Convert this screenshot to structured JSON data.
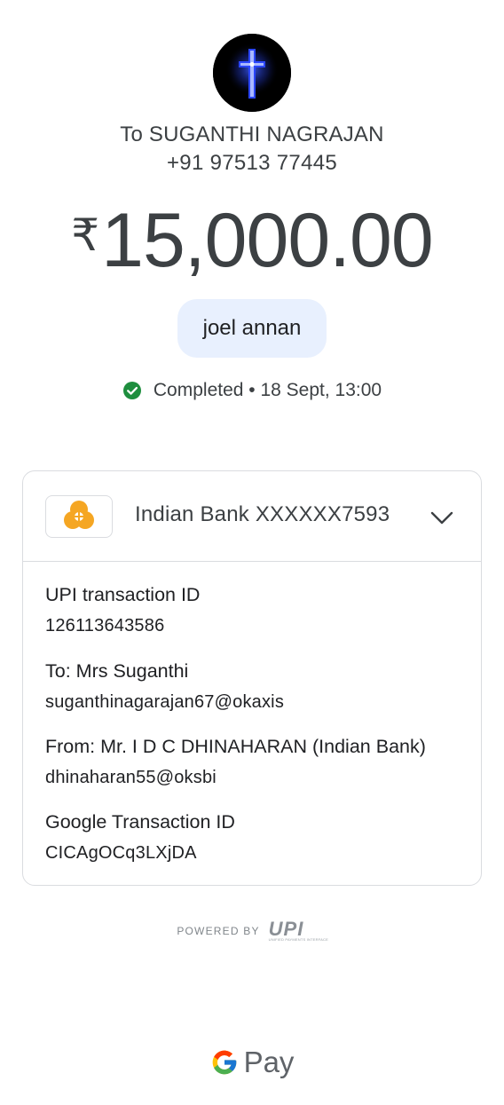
{
  "recipient": {
    "name": "To SUGANTHI NAGRAJAN",
    "phone": "+91 97513 77445",
    "avatar_icon": "cross-icon"
  },
  "amount": {
    "currency": "₹",
    "value": "15,000.00"
  },
  "note": "joel annan",
  "status": {
    "icon": "check-circle-icon",
    "text": "Completed • 18 Sept, 13:00",
    "color": "#1e8e3e"
  },
  "account": {
    "bank_logo_icon": "indian-bank-logo",
    "bank_name": "Indian Bank XXXXXX7593",
    "expand_icon": "chevron-down-icon"
  },
  "details": [
    {
      "label": "UPI transaction ID",
      "value": "126113643586"
    },
    {
      "label": "To: Mrs Suganthi",
      "value": "suganthinagarajan67@okaxis"
    },
    {
      "label": "From: Mr. I D C DHINAHARAN (Indian Bank)",
      "value": "dhinaharan55@oksbi"
    },
    {
      "label": "Google Transaction ID",
      "value": "CICAgOCq3LXjDA"
    }
  ],
  "footer": {
    "powered_by": "POWERED BY",
    "upi_logo": "UPI",
    "upi_tagline": "UNIFIED PAYMENTS INTERFACE",
    "brand": "Pay"
  },
  "colors": {
    "pill_bg": "#e8f0fe",
    "text_primary": "#3c4043",
    "border": "#dadce0",
    "bank_logo": "#f5a623"
  }
}
